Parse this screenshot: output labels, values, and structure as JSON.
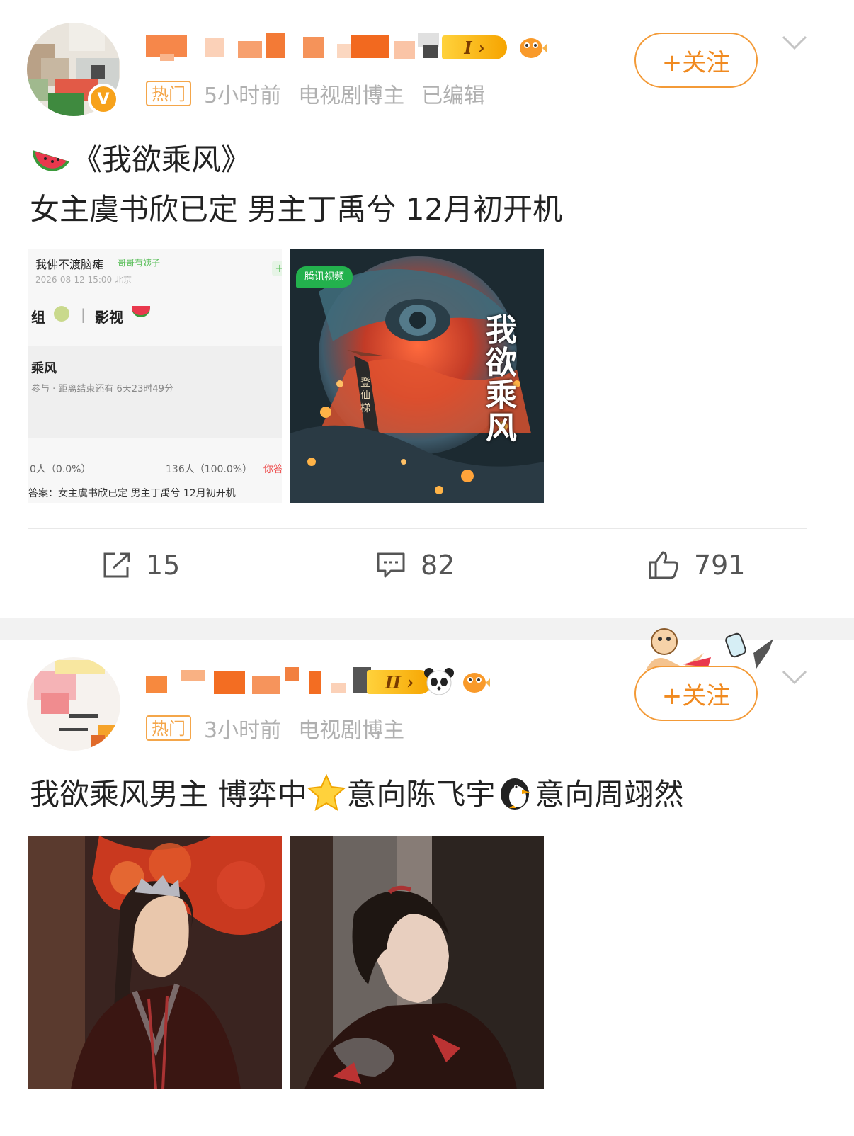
{
  "post1": {
    "meta": {
      "hot_label": "热门",
      "time": "5小时前",
      "role": "电视剧博主",
      "edited": "已编辑"
    },
    "level": "I",
    "follow_label": "+关注",
    "title_line": "《我欲乘风》",
    "body_line": "女主虞书欣已定 男主丁禹兮 12月初开机",
    "images": {
      "screenshot": {
        "poster_name": "我佛不渡脑瘫",
        "poster_tag": "哥哥有姨子",
        "date": "2026-08-12 15:00 北京",
        "group_label": "组",
        "section": "影视",
        "topic": "乘风",
        "participate": "参与 · 距离结束还有 6天23时49分",
        "left_count": "0人（0.0%）",
        "right_count": "136人（100.0%）",
        "you_answer": "你答",
        "answer": "答案：女主虞书欣已定 男主丁禹兮 12月初开机"
      },
      "poster": {
        "platform": "腾讯视频",
        "title_chars": [
          "我",
          "欲",
          "乘",
          "风"
        ],
        "pillar_text": "登仙梯"
      }
    },
    "actions": {
      "repost": "15",
      "comment": "82",
      "like": "791"
    }
  },
  "post2": {
    "meta": {
      "hot_label": "热门",
      "time": "3小时前",
      "role": "电视剧博主"
    },
    "level": "II",
    "follow_label": "+关注",
    "body_text_1": "我欲乘风男主 博弈中 ",
    "body_text_2": "意向陈飞宇 ",
    "body_text_3": "意向周翊然"
  },
  "colors": {
    "accent": "#f08a20",
    "hot": "#f4a64a",
    "meta": "#b0b0b0",
    "verify": "#f7a21b",
    "separator": "#f2f2f2"
  },
  "icons": [
    "chevron-down-icon",
    "repost-icon",
    "comment-icon",
    "like-icon",
    "watermelon-icon",
    "star-icon",
    "penguin-icon",
    "panda-icon",
    "pufferfish-icon",
    "verified-icon"
  ]
}
